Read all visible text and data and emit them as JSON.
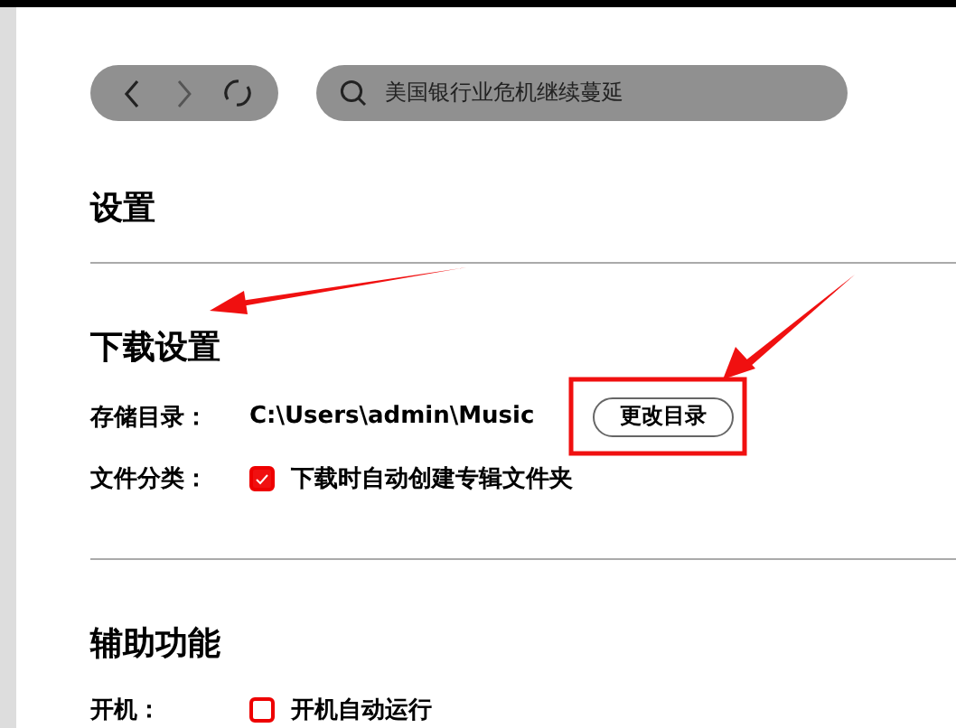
{
  "toolbar": {
    "search": {
      "value": "美国银行业危机继续蔓延"
    }
  },
  "page_title": "设置",
  "sections": [
    {
      "title": "下载设置",
      "rows": [
        {
          "kind": "path",
          "label": "存储目录：",
          "value": "C:\\Users\\admin\\Music",
          "button": "更改目录"
        },
        {
          "kind": "checkbox",
          "label": "文件分类：",
          "option": "下载时自动创建专辑文件夹",
          "checked": true
        }
      ]
    },
    {
      "title": "辅助功能",
      "rows": [
        {
          "kind": "checkbox",
          "label": "开机：",
          "option": "开机自动运行",
          "checked": false
        }
      ]
    }
  ]
}
